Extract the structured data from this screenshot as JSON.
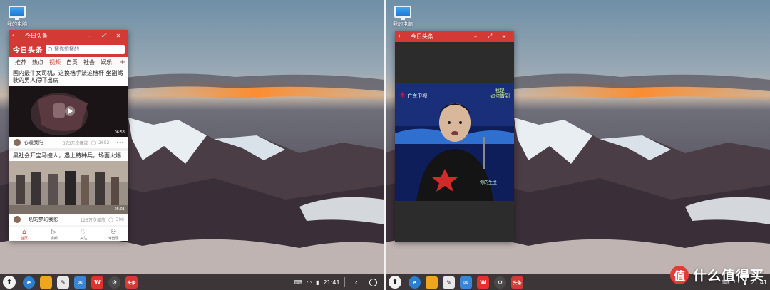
{
  "desktop": {
    "icon_label": "我的电脑"
  },
  "feed_window": {
    "title": "今日头条",
    "logo": "今日头条",
    "search_placeholder": "搜你想搜的",
    "tabs": [
      "推荐",
      "热点",
      "视频",
      "自贡",
      "社会",
      "娱乐"
    ],
    "active_tab": "视频",
    "articles": [
      {
        "title": "国内最牛女司机，这换档手法这档杆 坐副驾驶的男人得吓出病",
        "duration": "06:53",
        "author": "心暖我阳",
        "views": "373万次播放",
        "comments": "2652"
      },
      {
        "title": "黑社会开宝马撞人，遇上特种兵，场面火爆",
        "duration": "05:01",
        "author": "一切的梦幻我影",
        "views": "126万次播放",
        "comments": "398"
      }
    ],
    "bottom_nav": [
      "首页",
      "视频",
      "关注",
      "未登录"
    ]
  },
  "video_window": {
    "title": "今日头条",
    "channel_logo": "广东卫视",
    "watermark_line1": "我是",
    "watermark_line2": "如何做到",
    "caption": "你的生主"
  },
  "taskbar": {
    "time": "21:41",
    "app_tag": "头条"
  },
  "brand": {
    "badge": "值",
    "text": "什么值得买"
  },
  "colors": {
    "accent": "#d33a35",
    "taskbar": "#1e1a1e"
  }
}
